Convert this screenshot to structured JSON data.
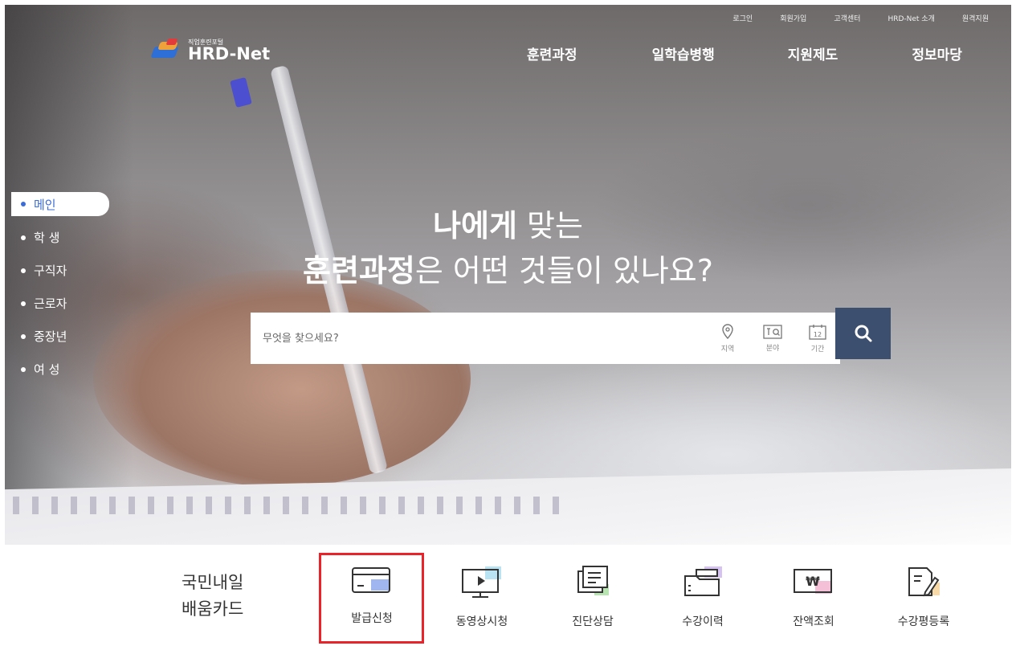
{
  "top_links": [
    "로그인",
    "회원가입",
    "고객센터",
    "HRD-Net 소개",
    "원격지원"
  ],
  "logo": {
    "subtitle": "직업훈련포털",
    "name": "HRD-Net"
  },
  "main_nav": [
    "훈련과정",
    "일학습병행",
    "지원제도",
    "정보마당"
  ],
  "side_menu": [
    "메인",
    "학 생",
    "구직자",
    "근로자",
    "중장년",
    "여 성"
  ],
  "headline": {
    "line1_strong": "나에게",
    "line1_rest": " 맞는",
    "line2_strong": "훈련과정",
    "line2_rest": "은 어떤 것들이 있나요?"
  },
  "search": {
    "placeholder": "무엇을 찾으세요?",
    "filters": [
      "지역",
      "분야",
      "기간"
    ]
  },
  "card_section": {
    "title_line1": "국민내일",
    "title_line2": "배움카드"
  },
  "services": [
    "발급신청",
    "동영상시청",
    "진단상담",
    "수강이력",
    "잔액조회",
    "수강평등록"
  ],
  "colors": {
    "accent": "#3c6cd8",
    "search_button": "#3d4f6e",
    "highlight": "#e8242a"
  }
}
